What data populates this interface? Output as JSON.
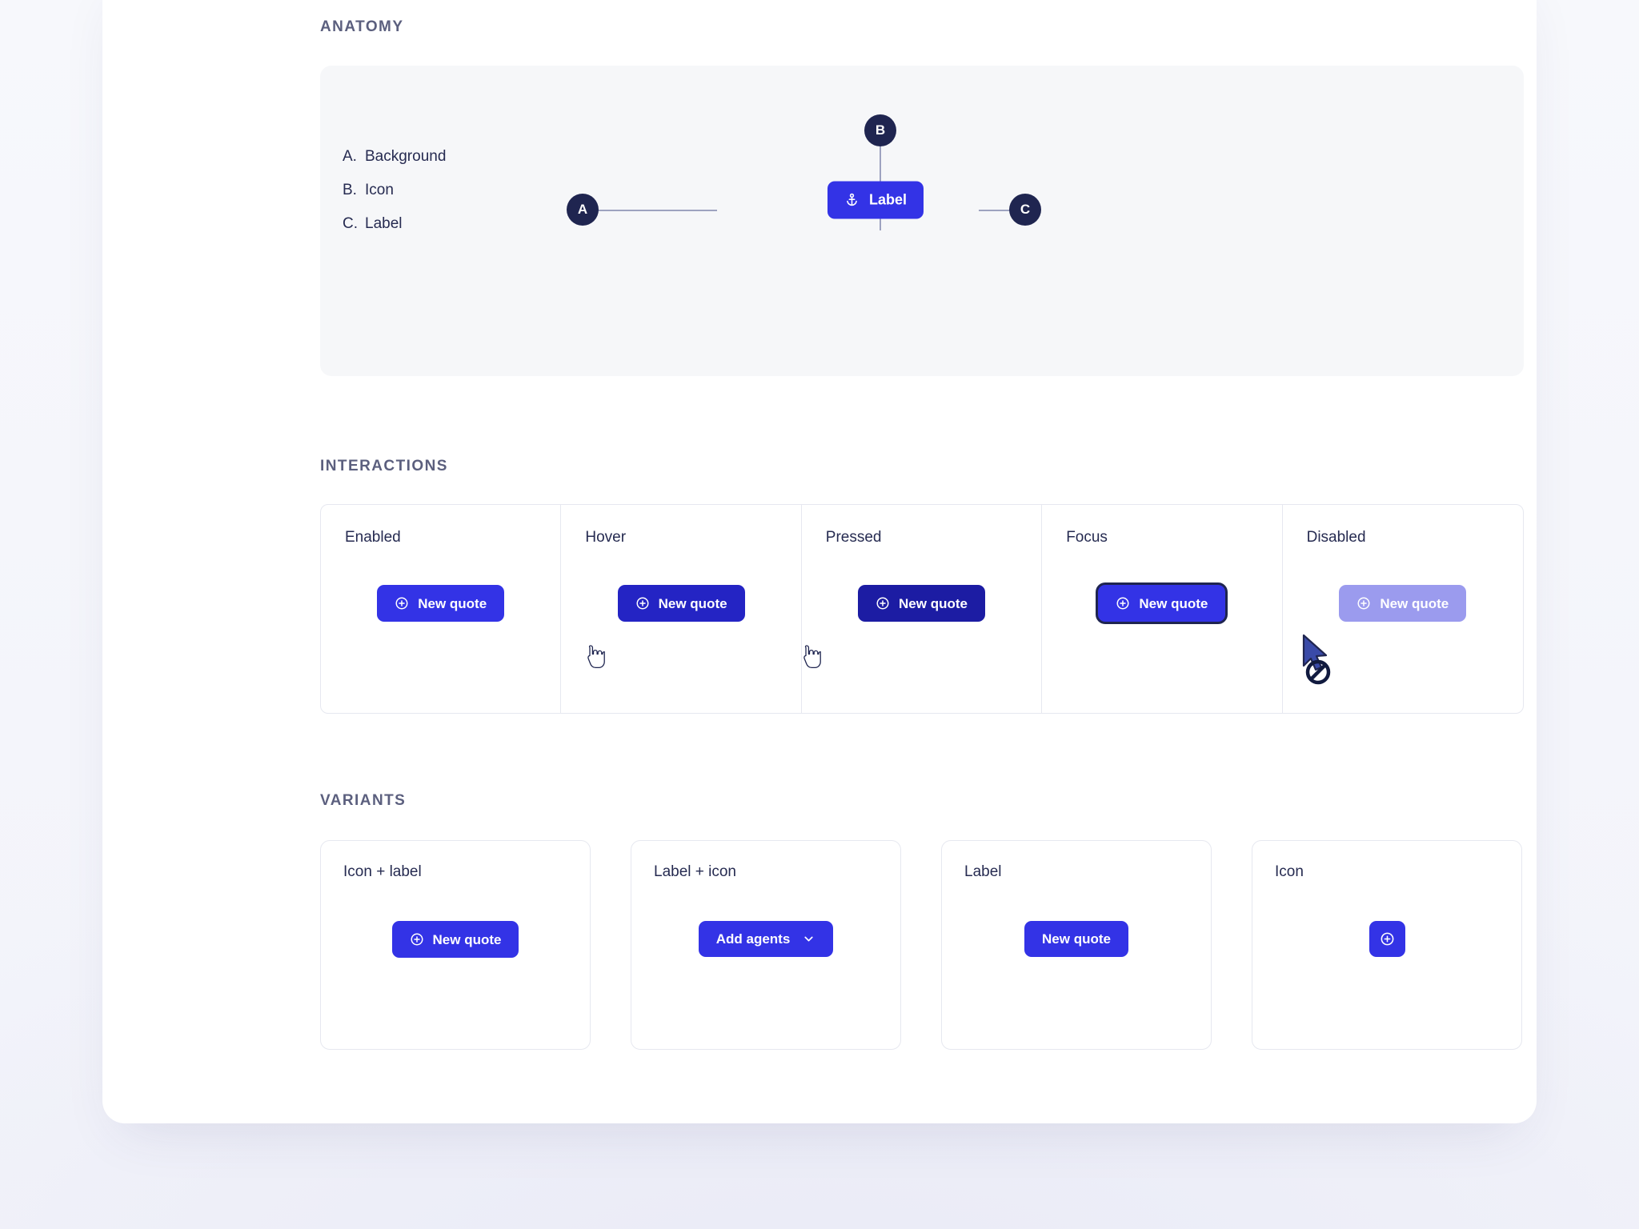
{
  "theme": {
    "page_background": "#f3f4fb",
    "panel_background": "#ffffff",
    "brand_blue": "#3333e6",
    "hover_blue": "#2424c4",
    "pressed_blue": "#1c1ca3",
    "disabled_blue": "#9b9bee",
    "focus_ring": "#1f2550",
    "node_navy": "#1f2550",
    "text_dark": "#262b51",
    "heading_muted": "#5b5f7e",
    "border_light": "#e6e8f0",
    "stage_background": "#f6f7f9",
    "leader_line": "#9ea3c0"
  },
  "sections": {
    "anatomy": {
      "title": "ANATOMY"
    },
    "interactions": {
      "title": "INTERACTIONS"
    },
    "variants": {
      "title": "VARIANTS"
    }
  },
  "anatomy": {
    "nodes": [
      {
        "key": "A",
        "id": "node-a"
      },
      {
        "key": "B",
        "id": "node-b"
      },
      {
        "key": "C",
        "id": "node-c"
      }
    ],
    "sample_button": {
      "label": "Label",
      "icon": "anchor-icon"
    },
    "legend": [
      {
        "key": "A.",
        "label": "Background"
      },
      {
        "key": "B.",
        "label": "Icon"
      },
      {
        "key": "C.",
        "label": "Label"
      }
    ]
  },
  "interactions": {
    "states": [
      {
        "name": "Enabled",
        "button_label": "New quote",
        "icon": "plus-circle-icon",
        "cursor": null
      },
      {
        "name": "Hover",
        "button_label": "New quote",
        "icon": "plus-circle-icon",
        "cursor": "pointer-cursor"
      },
      {
        "name": "Pressed",
        "button_label": "New quote",
        "icon": "plus-circle-icon",
        "cursor": "pointer-cursor"
      },
      {
        "name": "Focus",
        "button_label": "New quote",
        "icon": "plus-circle-icon",
        "cursor": null
      },
      {
        "name": "Disabled",
        "button_label": "New quote",
        "icon": "plus-circle-icon",
        "cursor": "not-allowed-cursor"
      }
    ]
  },
  "variants": {
    "cards": [
      {
        "name": "Icon + label",
        "button_label": "New quote",
        "leading_icon": "plus-circle-icon",
        "trailing_icon": null
      },
      {
        "name": "Label + icon",
        "button_label": "Add agents",
        "leading_icon": null,
        "trailing_icon": "chevron-down-icon"
      },
      {
        "name": "Label",
        "button_label": "New quote",
        "leading_icon": null,
        "trailing_icon": null
      },
      {
        "name": "Icon",
        "button_label": "",
        "leading_icon": "plus-circle-icon",
        "trailing_icon": null
      }
    ]
  }
}
